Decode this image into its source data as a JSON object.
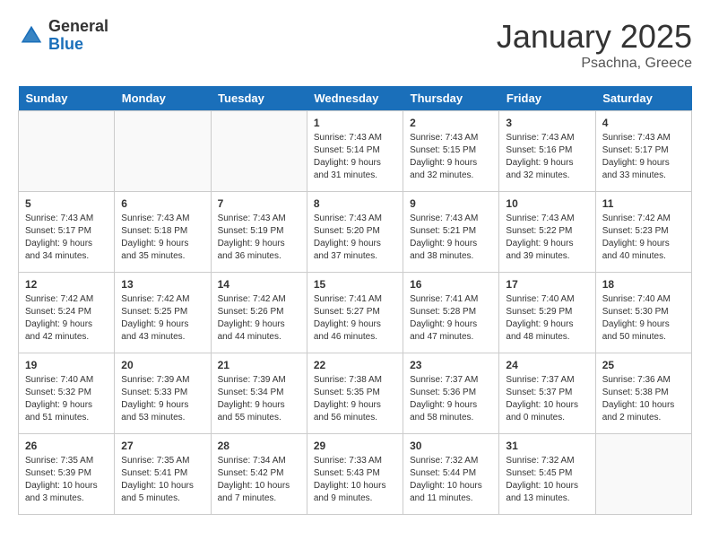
{
  "logo": {
    "general": "General",
    "blue": "Blue"
  },
  "title": "January 2025",
  "subtitle": "Psachna, Greece",
  "headers": [
    "Sunday",
    "Monday",
    "Tuesday",
    "Wednesday",
    "Thursday",
    "Friday",
    "Saturday"
  ],
  "weeks": [
    [
      {
        "day": "",
        "info": ""
      },
      {
        "day": "",
        "info": ""
      },
      {
        "day": "",
        "info": ""
      },
      {
        "day": "1",
        "info": "Sunrise: 7:43 AM\nSunset: 5:14 PM\nDaylight: 9 hours\nand 31 minutes."
      },
      {
        "day": "2",
        "info": "Sunrise: 7:43 AM\nSunset: 5:15 PM\nDaylight: 9 hours\nand 32 minutes."
      },
      {
        "day": "3",
        "info": "Sunrise: 7:43 AM\nSunset: 5:16 PM\nDaylight: 9 hours\nand 32 minutes."
      },
      {
        "day": "4",
        "info": "Sunrise: 7:43 AM\nSunset: 5:17 PM\nDaylight: 9 hours\nand 33 minutes."
      }
    ],
    [
      {
        "day": "5",
        "info": "Sunrise: 7:43 AM\nSunset: 5:17 PM\nDaylight: 9 hours\nand 34 minutes."
      },
      {
        "day": "6",
        "info": "Sunrise: 7:43 AM\nSunset: 5:18 PM\nDaylight: 9 hours\nand 35 minutes."
      },
      {
        "day": "7",
        "info": "Sunrise: 7:43 AM\nSunset: 5:19 PM\nDaylight: 9 hours\nand 36 minutes."
      },
      {
        "day": "8",
        "info": "Sunrise: 7:43 AM\nSunset: 5:20 PM\nDaylight: 9 hours\nand 37 minutes."
      },
      {
        "day": "9",
        "info": "Sunrise: 7:43 AM\nSunset: 5:21 PM\nDaylight: 9 hours\nand 38 minutes."
      },
      {
        "day": "10",
        "info": "Sunrise: 7:43 AM\nSunset: 5:22 PM\nDaylight: 9 hours\nand 39 minutes."
      },
      {
        "day": "11",
        "info": "Sunrise: 7:42 AM\nSunset: 5:23 PM\nDaylight: 9 hours\nand 40 minutes."
      }
    ],
    [
      {
        "day": "12",
        "info": "Sunrise: 7:42 AM\nSunset: 5:24 PM\nDaylight: 9 hours\nand 42 minutes."
      },
      {
        "day": "13",
        "info": "Sunrise: 7:42 AM\nSunset: 5:25 PM\nDaylight: 9 hours\nand 43 minutes."
      },
      {
        "day": "14",
        "info": "Sunrise: 7:42 AM\nSunset: 5:26 PM\nDaylight: 9 hours\nand 44 minutes."
      },
      {
        "day": "15",
        "info": "Sunrise: 7:41 AM\nSunset: 5:27 PM\nDaylight: 9 hours\nand 46 minutes."
      },
      {
        "day": "16",
        "info": "Sunrise: 7:41 AM\nSunset: 5:28 PM\nDaylight: 9 hours\nand 47 minutes."
      },
      {
        "day": "17",
        "info": "Sunrise: 7:40 AM\nSunset: 5:29 PM\nDaylight: 9 hours\nand 48 minutes."
      },
      {
        "day": "18",
        "info": "Sunrise: 7:40 AM\nSunset: 5:30 PM\nDaylight: 9 hours\nand 50 minutes."
      }
    ],
    [
      {
        "day": "19",
        "info": "Sunrise: 7:40 AM\nSunset: 5:32 PM\nDaylight: 9 hours\nand 51 minutes."
      },
      {
        "day": "20",
        "info": "Sunrise: 7:39 AM\nSunset: 5:33 PM\nDaylight: 9 hours\nand 53 minutes."
      },
      {
        "day": "21",
        "info": "Sunrise: 7:39 AM\nSunset: 5:34 PM\nDaylight: 9 hours\nand 55 minutes."
      },
      {
        "day": "22",
        "info": "Sunrise: 7:38 AM\nSunset: 5:35 PM\nDaylight: 9 hours\nand 56 minutes."
      },
      {
        "day": "23",
        "info": "Sunrise: 7:37 AM\nSunset: 5:36 PM\nDaylight: 9 hours\nand 58 minutes."
      },
      {
        "day": "24",
        "info": "Sunrise: 7:37 AM\nSunset: 5:37 PM\nDaylight: 10 hours\nand 0 minutes."
      },
      {
        "day": "25",
        "info": "Sunrise: 7:36 AM\nSunset: 5:38 PM\nDaylight: 10 hours\nand 2 minutes."
      }
    ],
    [
      {
        "day": "26",
        "info": "Sunrise: 7:35 AM\nSunset: 5:39 PM\nDaylight: 10 hours\nand 3 minutes."
      },
      {
        "day": "27",
        "info": "Sunrise: 7:35 AM\nSunset: 5:41 PM\nDaylight: 10 hours\nand 5 minutes."
      },
      {
        "day": "28",
        "info": "Sunrise: 7:34 AM\nSunset: 5:42 PM\nDaylight: 10 hours\nand 7 minutes."
      },
      {
        "day": "29",
        "info": "Sunrise: 7:33 AM\nSunset: 5:43 PM\nDaylight: 10 hours\nand 9 minutes."
      },
      {
        "day": "30",
        "info": "Sunrise: 7:32 AM\nSunset: 5:44 PM\nDaylight: 10 hours\nand 11 minutes."
      },
      {
        "day": "31",
        "info": "Sunrise: 7:32 AM\nSunset: 5:45 PM\nDaylight: 10 hours\nand 13 minutes."
      },
      {
        "day": "",
        "info": ""
      }
    ]
  ]
}
